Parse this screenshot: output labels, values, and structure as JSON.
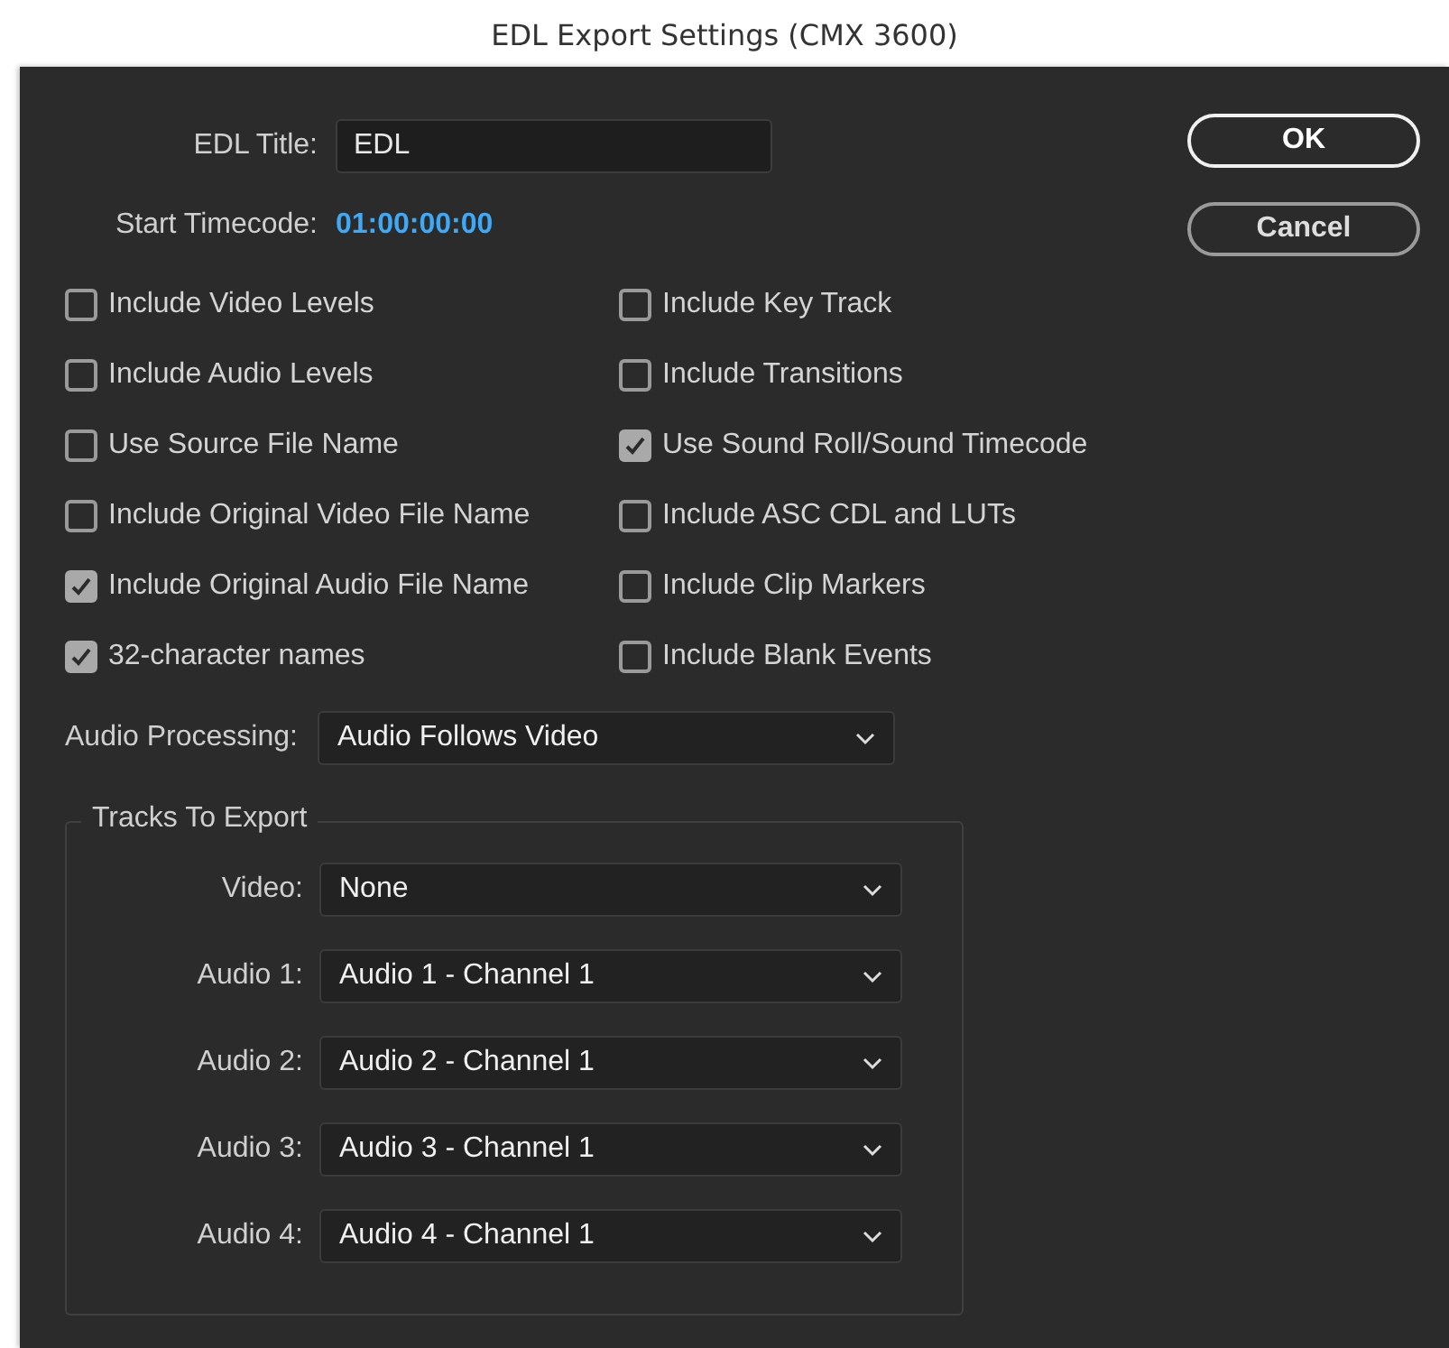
{
  "window": {
    "title": "EDL Export Settings (CMX 3600)"
  },
  "edl_title": {
    "label": "EDL Title:",
    "value": "EDL"
  },
  "start_timecode": {
    "label": "Start Timecode:",
    "value": "01:00:00:00"
  },
  "buttons": [
    {
      "label": "OK",
      "default": true
    },
    {
      "label": "Cancel",
      "default": false
    }
  ],
  "options_left": [
    {
      "label": "Include Video Levels",
      "checked": false
    },
    {
      "label": "Include Audio Levels",
      "checked": false
    },
    {
      "label": "Use Source File Name",
      "checked": false
    },
    {
      "label": "Include Original Video File Name",
      "checked": false
    },
    {
      "label": "Include Original Audio File Name",
      "checked": true
    },
    {
      "label": "32-character names",
      "checked": true
    }
  ],
  "options_right": [
    {
      "label": "Include Key Track",
      "checked": false
    },
    {
      "label": "Include Transitions",
      "checked": false
    },
    {
      "label": "Use Sound Roll/Sound Timecode",
      "checked": true
    },
    {
      "label": "Include ASC CDL and LUTs",
      "checked": false
    },
    {
      "label": "Include Clip Markers",
      "checked": false
    },
    {
      "label": "Include Blank Events",
      "checked": false
    }
  ],
  "audio_processing": {
    "label": "Audio Processing:",
    "value": "Audio Follows Video"
  },
  "tracks_to_export": {
    "title": "Tracks To Export",
    "tracks": [
      {
        "label": "Video:",
        "value": "None"
      },
      {
        "label": "Audio 1:",
        "value": "Audio 1 - Channel 1"
      },
      {
        "label": "Audio 2:",
        "value": "Audio 2 - Channel 1"
      },
      {
        "label": "Audio 3:",
        "value": "Audio 3 - Channel 1"
      },
      {
        "label": "Audio 4:",
        "value": "Audio 4 - Channel 1"
      }
    ]
  }
}
